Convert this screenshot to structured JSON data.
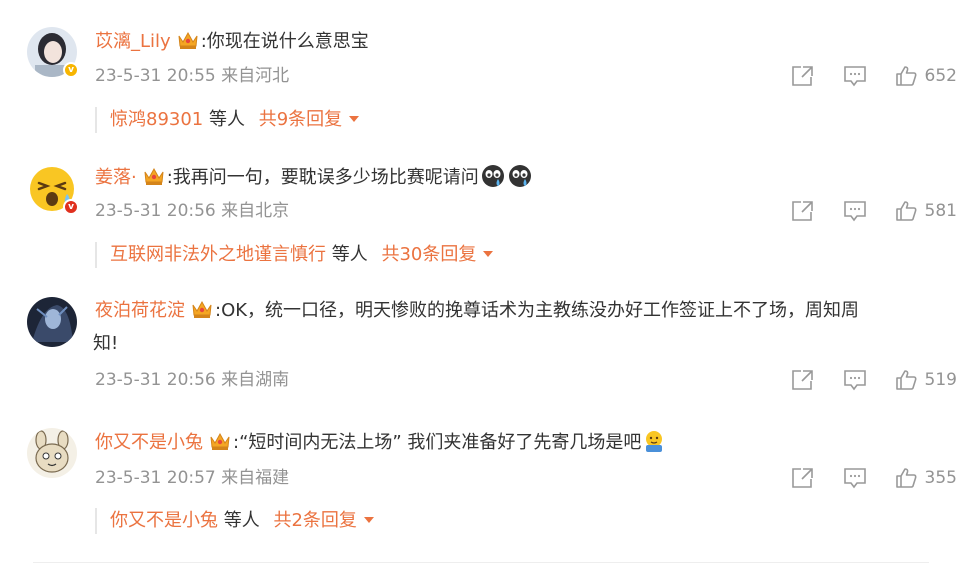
{
  "comments": [
    {
      "username": "苡漓_Lily",
      "text": ":你现在说什么意思宝",
      "time": "23-5-31 20:55",
      "location": "来自河北",
      "likes": "652",
      "badge_color": "#f7b500",
      "reply": {
        "who": "惊鸿89301",
        "mid": "等人",
        "more": "共9条回复"
      }
    },
    {
      "username": "姜落·",
      "text": ":我再问一句，要耽误多少场比赛呢请问",
      "time": "23-5-31 20:56",
      "location": "来自北京",
      "likes": "581",
      "badge_color": "#e0301e",
      "reply": {
        "who": "互联网非法外之地谨言慎行",
        "mid": "等人",
        "more": "共30条回复"
      }
    },
    {
      "username": "夜泊荷花淀",
      "text": ":OK，统一口径，明天惨败的挽尊话术为主教练没办好工作签证上不了场，周知周",
      "text2": "知!",
      "time": "23-5-31 20:56",
      "location": "来自湖南",
      "likes": "519"
    },
    {
      "username": "你又不是小兔",
      "text": ":“短时间内无法上场” 我们夹准备好了先寄几场是吧",
      "time": "23-5-31 20:57",
      "location": "来自福建",
      "likes": "355",
      "reply": {
        "who": "你又不是小兔",
        "mid": "等人",
        "more": "共2条回复"
      }
    }
  ],
  "icons": {
    "share": "share-icon",
    "comment": "comment-icon",
    "like": "thumbs-up-icon",
    "crown": "crown-icon",
    "caret": "caret-down-icon"
  },
  "colors": {
    "username": "#eb7340",
    "meta": "#939393",
    "text": "#333333"
  }
}
